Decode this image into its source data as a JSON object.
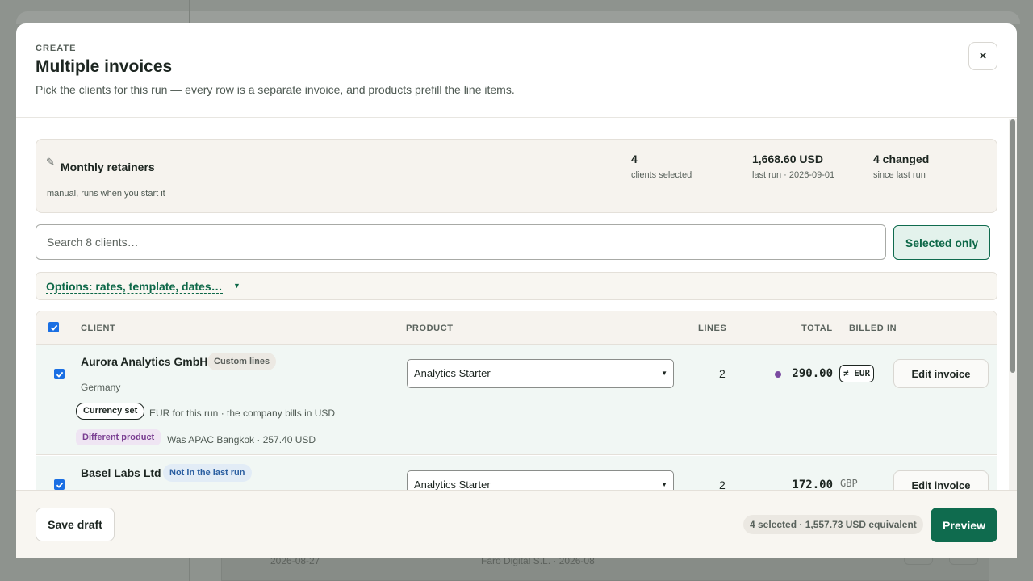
{
  "background": {
    "row_date": "2026-08-27",
    "row_ref": "Faro Digital S.L. · 2026-08"
  },
  "header": {
    "eyebrow": "CREATE",
    "title": "Multiple invoices",
    "subtitle": "Pick the clients for this run — every row is a separate invoice, and products prefill the line items.",
    "close_label": "×"
  },
  "summary": {
    "icon": "pencil-icon",
    "run_name": "Monthly retainers",
    "run_desc": "manual, runs when you start it",
    "stats": [
      {
        "value": "4",
        "label": "clients selected"
      },
      {
        "value": "1,668.60 USD",
        "label": "last run · 2026-09-01"
      },
      {
        "value": "4 changed",
        "label": "since last run"
      }
    ]
  },
  "search": {
    "placeholder": "Search 8 clients…",
    "value": ""
  },
  "filter": {
    "selected_only_label": "Selected only"
  },
  "options": {
    "label": "Options: rates, template, dates…",
    "caret": "▼"
  },
  "table": {
    "columns": {
      "client": "CLIENT",
      "product": "PRODUCT",
      "lines": "LINES",
      "total": "TOTAL",
      "billed_in": "BILLED IN"
    },
    "rows": [
      {
        "selected": true,
        "name": "Aurora Analytics GmbH",
        "tag": "Custom lines",
        "country": "Germany",
        "currency_tag": "Currency set",
        "currency_note": "EUR for this run · the company bills in USD",
        "product_tag": "Different product",
        "product_note": "Was APAC Bangkok · 257.40 USD",
        "product": "Analytics Starter",
        "lines": "2",
        "total": "290.00",
        "billed_in": "≠ EUR",
        "action": "Edit invoice"
      },
      {
        "selected": true,
        "name": "Basel Labs Ltd",
        "tag": "Not in the last run",
        "product": "Analytics Starter",
        "lines": "2",
        "total": "172.00",
        "billed_in": "GBP",
        "action": "Edit invoice"
      }
    ]
  },
  "footer": {
    "save_draft_label": "Save draft",
    "summary": "4 selected · 1,557.73 USD equivalent",
    "preview_label": "Preview"
  },
  "colors": {
    "accent": "#0f6b4e",
    "checkbox": "#1a6fe3",
    "changed_dot": "#7a4aa0"
  }
}
